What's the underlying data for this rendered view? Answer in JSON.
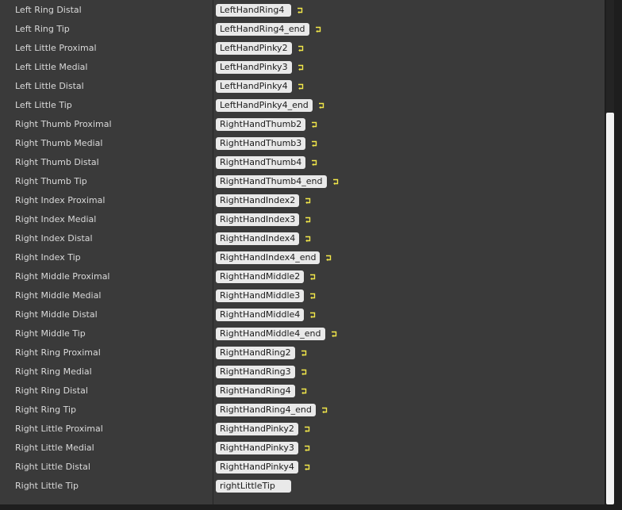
{
  "bone_mapping": {
    "rows": [
      {
        "label": "Left Ring Distal",
        "value": "LeftHandRing4",
        "has_reset": true
      },
      {
        "label": "Left Ring Tip",
        "value": "LeftHandRing4_end",
        "has_reset": true
      },
      {
        "label": "Left Little Proximal",
        "value": "LeftHandPinky2",
        "has_reset": true
      },
      {
        "label": "Left Little Medial",
        "value": "LeftHandPinky3",
        "has_reset": true
      },
      {
        "label": "Left Little Distal",
        "value": "LeftHandPinky4",
        "has_reset": true
      },
      {
        "label": "Left Little Tip",
        "value": "LeftHandPinky4_end",
        "has_reset": true
      },
      {
        "label": "Right Thumb Proximal",
        "value": "RightHandThumb2",
        "has_reset": true
      },
      {
        "label": "Right Thumb Medial",
        "value": "RightHandThumb3",
        "has_reset": true
      },
      {
        "label": "Right Thumb Distal",
        "value": "RightHandThumb4",
        "has_reset": true
      },
      {
        "label": "Right Thumb Tip",
        "value": "RightHandThumb4_end",
        "has_reset": true
      },
      {
        "label": "Right Index Proximal",
        "value": "RightHandIndex2",
        "has_reset": true
      },
      {
        "label": "Right Index Medial",
        "value": "RightHandIndex3",
        "has_reset": true
      },
      {
        "label": "Right Index Distal",
        "value": "RightHandIndex4",
        "has_reset": true
      },
      {
        "label": "Right Index Tip",
        "value": "RightHandIndex4_end",
        "has_reset": true
      },
      {
        "label": "Right Middle Proximal",
        "value": "RightHandMiddle2",
        "has_reset": true
      },
      {
        "label": "Right Middle Medial",
        "value": "RightHandMiddle3",
        "has_reset": true
      },
      {
        "label": "Right Middle Distal",
        "value": "RightHandMiddle4",
        "has_reset": true
      },
      {
        "label": "Right Middle Tip",
        "value": "RightHandMiddle4_end",
        "has_reset": true
      },
      {
        "label": "Right Ring Proximal",
        "value": "RightHandRing2",
        "has_reset": true
      },
      {
        "label": "Right Ring Medial",
        "value": "RightHandRing3",
        "has_reset": true
      },
      {
        "label": "Right Ring Distal",
        "value": "RightHandRing4",
        "has_reset": true
      },
      {
        "label": "Right Ring Tip",
        "value": "RightHandRing4_end",
        "has_reset": true
      },
      {
        "label": "Right Little Proximal",
        "value": "RightHandPinky2",
        "has_reset": true
      },
      {
        "label": "Right Little Medial",
        "value": "RightHandPinky3",
        "has_reset": true
      },
      {
        "label": "Right Little Distal",
        "value": "RightHandPinky4",
        "has_reset": true
      },
      {
        "label": "Right Little Tip",
        "value": "rightLittleTip",
        "has_reset": false
      }
    ]
  },
  "icons": {
    "reset": "reset-to-default-arrow-icon"
  },
  "colors": {
    "panel_bg": "#3a3a3a",
    "label_text": "#d9d9d9",
    "value_bg": "#e9e9e9",
    "value_text": "#1b1b1b",
    "reset_icon": "#f3e84a",
    "scroll_thumb": "#f2f2f2"
  }
}
